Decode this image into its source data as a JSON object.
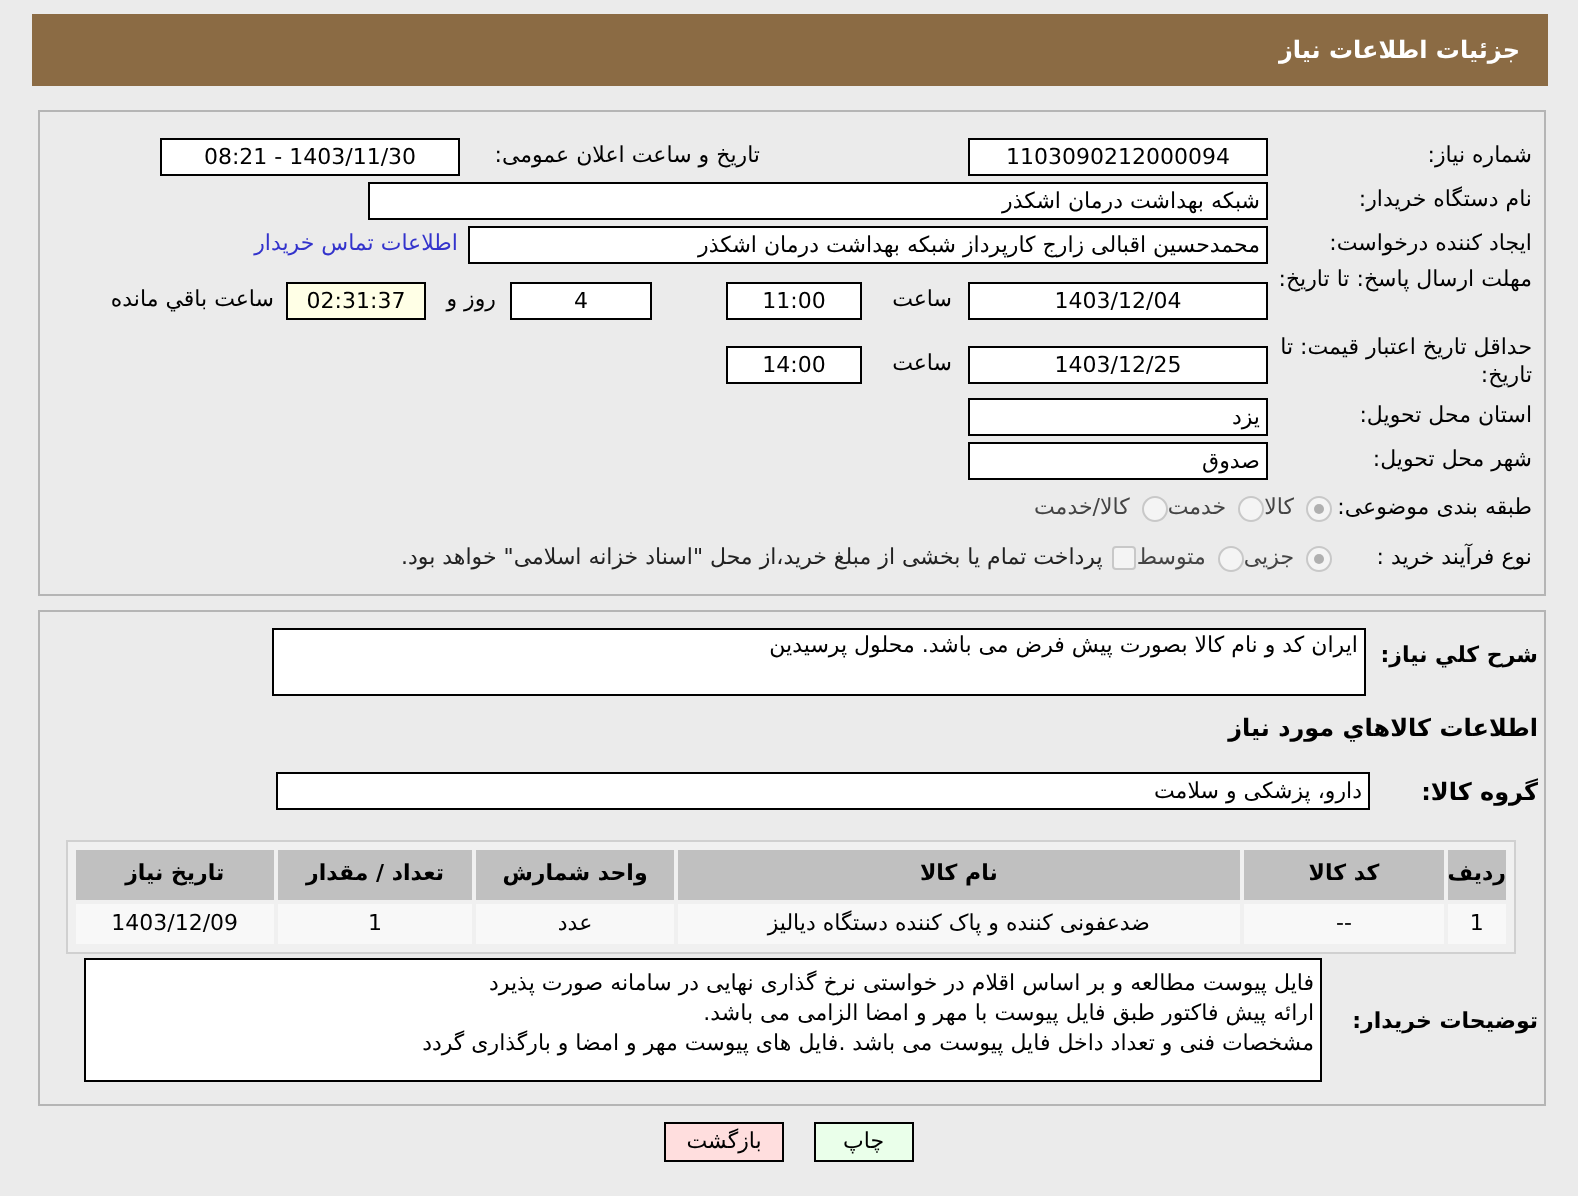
{
  "header": {
    "title": "جزئیات اطلاعات نیاز"
  },
  "need_number": {
    "label": "شماره نیاز:",
    "value": "1103090212000094"
  },
  "announce": {
    "label": "تاریخ و ساعت اعلان عمومی:",
    "value": "1403/11/30 - 08:21"
  },
  "buyer_org": {
    "label": "نام دستگاه خریدار:",
    "value": "شبکه بهداشت درمان اشکذر"
  },
  "requester": {
    "label": "ایجاد کننده درخواست:",
    "value": "محمدحسین اقبالی زارج کارپرداز شبکه بهداشت درمان اشکذر",
    "link": "اطلاعات تماس خریدار"
  },
  "deadline": {
    "label": "مهلت ارسال پاسخ: تا تاریخ:",
    "date": "1403/12/04",
    "time_label": "ساعت",
    "time": "11:00",
    "days": "4",
    "days_label": "روز و",
    "remaining": "02:31:37",
    "remaining_label": "ساعت باقي مانده"
  },
  "validity": {
    "label": "حداقل تاریخ اعتبار قیمت: تا تاریخ:",
    "date": "1403/12/25",
    "time_label": "ساعت",
    "time": "14:00"
  },
  "province": {
    "label": "استان محل تحویل:",
    "value": "یزد"
  },
  "city": {
    "label": "شهر محل تحویل:",
    "value": "صدوق"
  },
  "category": {
    "label": "طبقه بندی موضوعی:",
    "options": [
      {
        "label": "کالا",
        "selected": true
      },
      {
        "label": "خدمت",
        "selected": false
      },
      {
        "label": "کالا/خدمت",
        "selected": false
      }
    ]
  },
  "process": {
    "label": "نوع فرآیند خرید :",
    "options": [
      {
        "label": "جزیی",
        "selected": true
      },
      {
        "label": "متوسط",
        "selected": false
      }
    ],
    "payment": {
      "checked": false,
      "text": "پرداخت تمام یا بخشی از مبلغ خرید،از محل \"اسناد خزانه اسلامی\" خواهد بود."
    }
  },
  "description": {
    "label": "شرح کلي نياز:",
    "value": "ایران کد و نام کالا بصورت پیش فرض می باشد. محلول پرسیدین"
  },
  "goods_title": "اطلاعات کالاهاي مورد نياز",
  "group": {
    "label": "گروه کالا:",
    "value": "دارو، پزشکی و سلامت"
  },
  "table": {
    "columns": [
      "ردیف",
      "کد کالا",
      "نام کالا",
      "واحد شمارش",
      "تعداد / مقدار",
      "تاریخ نیاز"
    ],
    "rows": [
      [
        "1",
        "--",
        "ضدعفونی کننده و پاک کننده دستگاه دیالیز",
        "عدد",
        "1",
        "1403/12/09"
      ]
    ]
  },
  "buyer_notes": {
    "label": "توضیحات خریدار:",
    "lines": [
      "فایل پیوست مطالعه و بر اساس اقلام در خواستی نرخ گذاری نهایی در سامانه صورت پذیرد",
      "ارائه پیش فاکتور طبق فایل پیوست با مهر و امضا الزامی می باشد.",
      "مشخصات فنی و تعداد داخل فایل پیوست می باشد .فایل های پیوست مهر و امضا و بارگذاری گردد"
    ]
  },
  "buttons": [
    {
      "label": "چاپ",
      "kind": "print"
    },
    {
      "label": "بازگشت",
      "kind": "back"
    }
  ]
}
